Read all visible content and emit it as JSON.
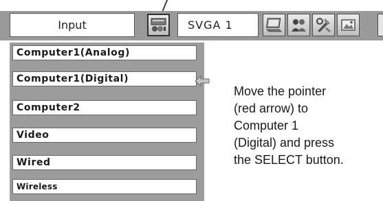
{
  "menu_bar": {
    "title": "Input",
    "mode_label": "SVGA 1",
    "icons": [
      "input-source-icon",
      "monitor-icon",
      "people-icon",
      "tools-icon",
      "picture-icon"
    ]
  },
  "input_menu": {
    "items": [
      {
        "label": "Computer1(Analog)"
      },
      {
        "label": "Computer1(Digital)"
      },
      {
        "label": "Computer2"
      },
      {
        "label": "Video"
      },
      {
        "label": "Wired"
      },
      {
        "label": "Wireless"
      }
    ]
  },
  "instruction": {
    "lines": [
      "Move the pointer",
      "(red arrow) to",
      "Computer 1",
      "(Digital) and press",
      "the SELECT button."
    ]
  },
  "colors": {
    "menu_background": "#9a9a9a",
    "box_background": "#ffffff",
    "pointer_color": "#bdbdbd"
  }
}
